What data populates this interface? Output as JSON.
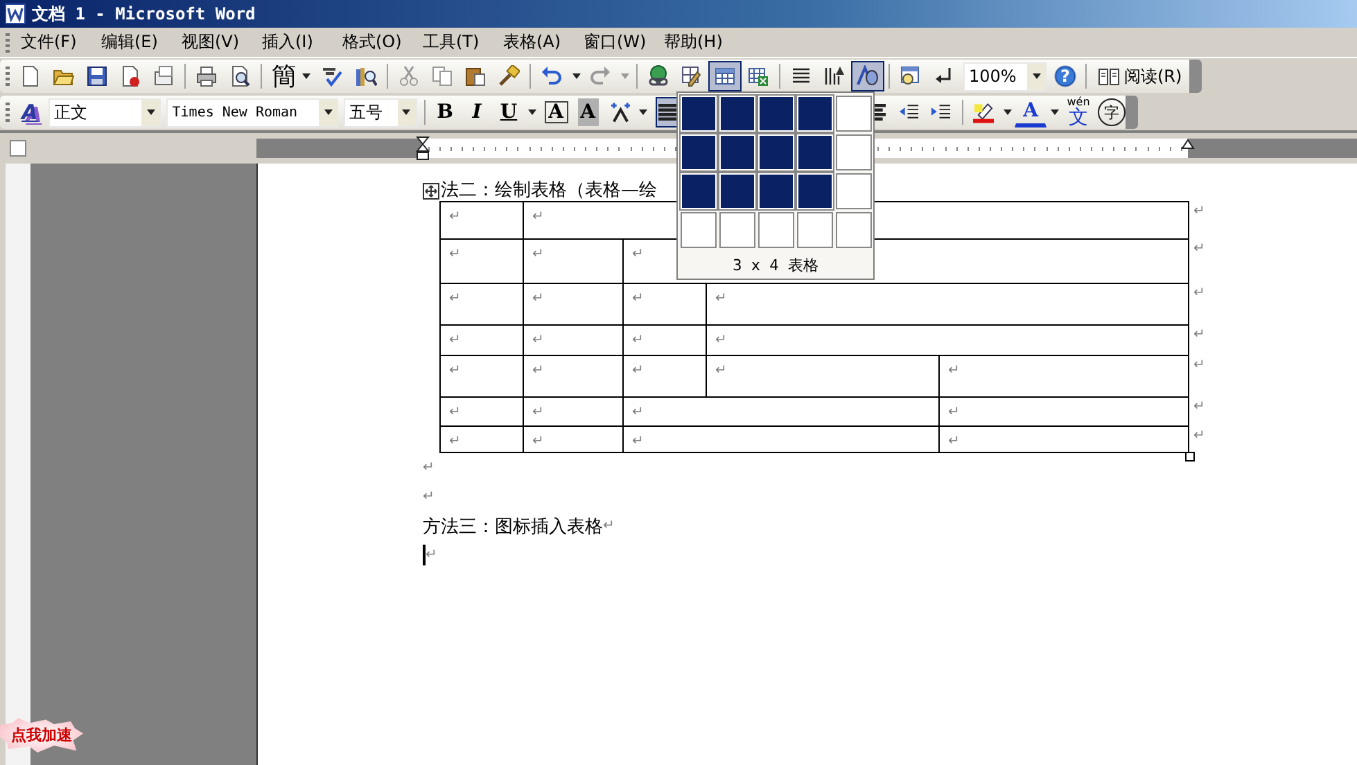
{
  "window": {
    "title": "文档 1 - Microsoft Word"
  },
  "menu": [
    "文件(F)",
    "编辑(E)",
    "视图(V)",
    "插入(I)",
    "格式(O)",
    "工具(T)",
    "表格(A)",
    "窗口(W)",
    "帮助(H)"
  ],
  "standard_toolbar": {
    "simplified": "簡",
    "edit_buttons": [
      {
        "disabled": true
      },
      {
        "disabled": true
      },
      {
        "disabled": false
      },
      {
        "disabled": false
      }
    ],
    "undo": {
      "disabled": false
    },
    "redo": {
      "disabled": true
    },
    "table_button": {
      "pressed": true
    },
    "drawing_button": {
      "pressed": true
    },
    "zoom": "100%",
    "help": "?",
    "read_button": "阅读(R)"
  },
  "formatting_toolbar": {
    "styles_icon": "A",
    "style": "正文",
    "font": "Times New Roman",
    "size": "五号",
    "format_buttons": [
      {
        "label": "B"
      },
      {
        "label": "I"
      },
      {
        "label": "U"
      }
    ],
    "border_char": "A",
    "shaded_char": "A",
    "justify_button": {
      "pressed": true
    },
    "font_color": "A",
    "phonetic": {
      "ruby": "wén",
      "base": "文"
    },
    "enclosed": "字"
  },
  "document": {
    "heading": "法二：绘制表格（表格—绘",
    "table": {
      "rows": [
        {
          "cells": [
            "↵",
            "↵"
          ],
          "end": "↵"
        },
        {
          "cells": [
            "↵",
            "↵",
            "↵"
          ],
          "end": "↵"
        },
        {
          "cells": [
            "↵",
            "↵",
            "↵",
            "↵"
          ],
          "end": "↵"
        },
        {
          "cells": [
            "↵",
            "↵",
            "↵",
            "↵"
          ],
          "end": "↵"
        },
        {
          "cells": [
            "↵",
            "↵",
            "↵",
            "↵",
            "↵"
          ],
          "end": "↵"
        },
        {
          "cells": [
            "↵",
            "↵",
            "↵",
            "↵"
          ],
          "end": "↵"
        },
        {
          "cells": [
            "↵",
            "↵",
            "↵",
            "↵"
          ],
          "end": "↵"
        }
      ]
    },
    "paragraphs": [
      {
        "mark": "↵",
        "cursor": false
      },
      {
        "mark": "↵",
        "cursor": false
      },
      {
        "text": "方法三：图标插入表格",
        "mark": "↵",
        "cursor": false
      },
      {
        "mark": "↵",
        "cursor": true
      }
    ]
  },
  "table_picker": {
    "rows": [
      [
        {
          "selected": true
        },
        {
          "selected": true
        },
        {
          "selected": true
        },
        {
          "selected": true
        },
        {
          "selected": false
        }
      ],
      [
        {
          "selected": true
        },
        {
          "selected": true
        },
        {
          "selected": true
        },
        {
          "selected": true
        },
        {
          "selected": false
        }
      ],
      [
        {
          "selected": true
        },
        {
          "selected": true
        },
        {
          "selected": true
        },
        {
          "selected": true
        },
        {
          "selected": false
        }
      ],
      [
        {
          "selected": false
        },
        {
          "selected": false
        },
        {
          "selected": false
        },
        {
          "selected": false
        },
        {
          "selected": false
        }
      ]
    ],
    "caption": "3 x 4 表格"
  },
  "speed_badge": "点我加速"
}
